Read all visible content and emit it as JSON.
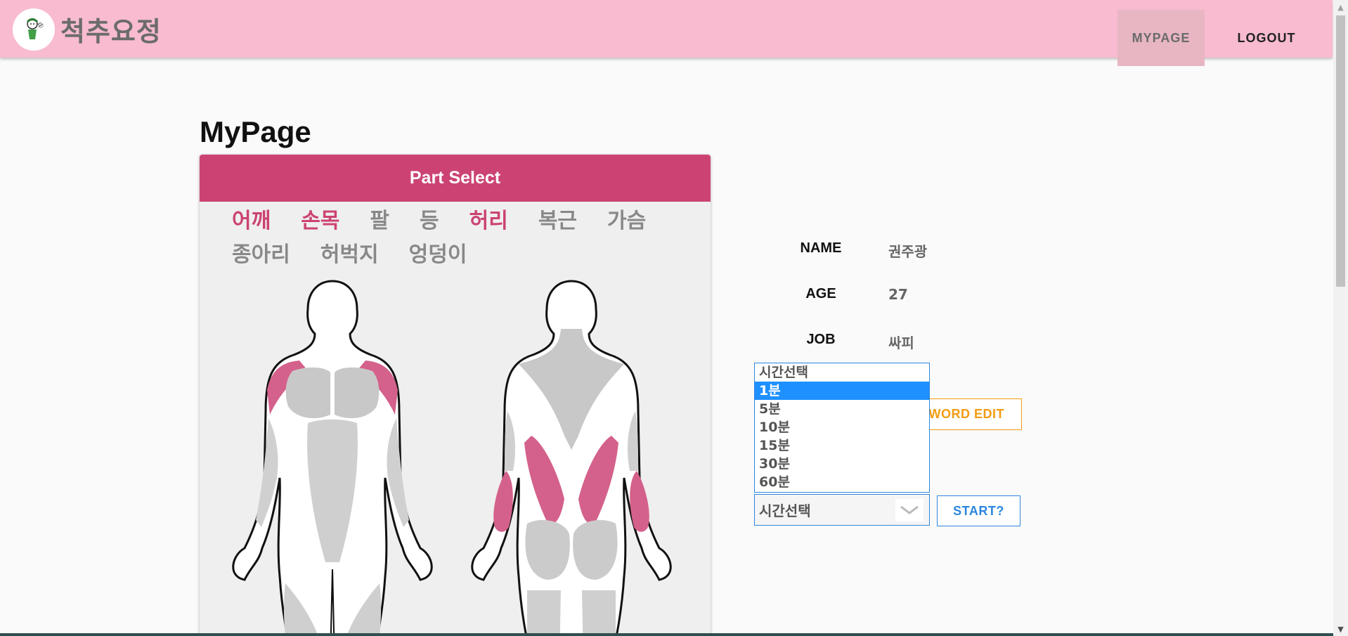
{
  "header": {
    "brand": "척추요정",
    "nav": {
      "mypage": "MYPAGE",
      "logout": "LOGOUT"
    }
  },
  "page": {
    "title": "MyPage"
  },
  "part_select": {
    "title": "Part Select",
    "parts": [
      {
        "label": "어깨",
        "active": true
      },
      {
        "label": "손목",
        "active": true
      },
      {
        "label": "팔",
        "active": false
      },
      {
        "label": "등",
        "active": false
      },
      {
        "label": "허리",
        "active": true
      },
      {
        "label": "복근",
        "active": false
      },
      {
        "label": "가슴",
        "active": false
      },
      {
        "label": "종아리",
        "active": false
      },
      {
        "label": "허벅지",
        "active": false
      },
      {
        "label": "엉덩이",
        "active": false
      }
    ],
    "highlight_color": "#d4618b"
  },
  "profile": {
    "name_label": "NAME",
    "name_value": "권주광",
    "age_label": "AGE",
    "age_value": "27",
    "job_label": "JOB",
    "job_value": "싸피"
  },
  "password_button": "WORD EDIT",
  "timer": {
    "select_value": "시간선택",
    "options": [
      "시간선택",
      "1분",
      "5분",
      "10분",
      "15분",
      "30분",
      "60분"
    ],
    "highlighted_option": "1분",
    "start_label": "START?"
  },
  "colors": {
    "header_bg": "#f8bbd0",
    "card_header": "#cc4373",
    "password_accent": "#f39c12",
    "start_accent": "#2e86de"
  }
}
